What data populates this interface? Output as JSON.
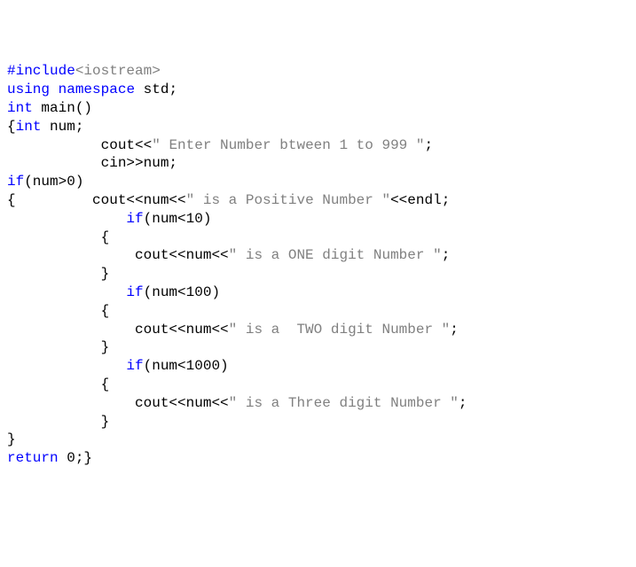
{
  "code": {
    "l1a": "#include",
    "l1b": "<iostream>",
    "l2a": "using",
    "l2b": " ",
    "l2c": "namespace",
    "l2d": " std;",
    "l3a": "int",
    "l3b": " main()",
    "l4a": "{",
    "l4b": "int",
    "l4c": " num;",
    "l5a": "           cout<<",
    "l5b": "\" Enter Number btween 1 to 999 \"",
    "l5c": ";",
    "l6": "           cin>>num;",
    "l7a": "if",
    "l7b": "(num>0)",
    "l8a": "{         cout<<num<<",
    "l8b": "\" is a Positive Number \"",
    "l8c": "<<endl;",
    "l9": "",
    "l10a": "              ",
    "l10b": "if",
    "l10c": "(num<10)",
    "l11": "           {",
    "l12a": "               cout<<num<<",
    "l12b": "\" is a ONE digit Number \"",
    "l12c": ";",
    "l13": "           }",
    "l14": "",
    "l15a": "              ",
    "l15b": "if",
    "l15c": "(num<100)",
    "l16": "           {",
    "l17a": "               cout<<num<<",
    "l17b": "\" is a  TWO digit Number \"",
    "l17c": ";",
    "l18": "           }",
    "l19": "",
    "l20a": "              ",
    "l20b": "if",
    "l20c": "(num<1000)",
    "l21": "           {",
    "l22a": "               cout<<num<<",
    "l22b": "\" is a Three digit Number \"",
    "l22c": ";",
    "l23": "           }",
    "l24": "}",
    "l25a": "return",
    "l25b": " 0;}"
  }
}
